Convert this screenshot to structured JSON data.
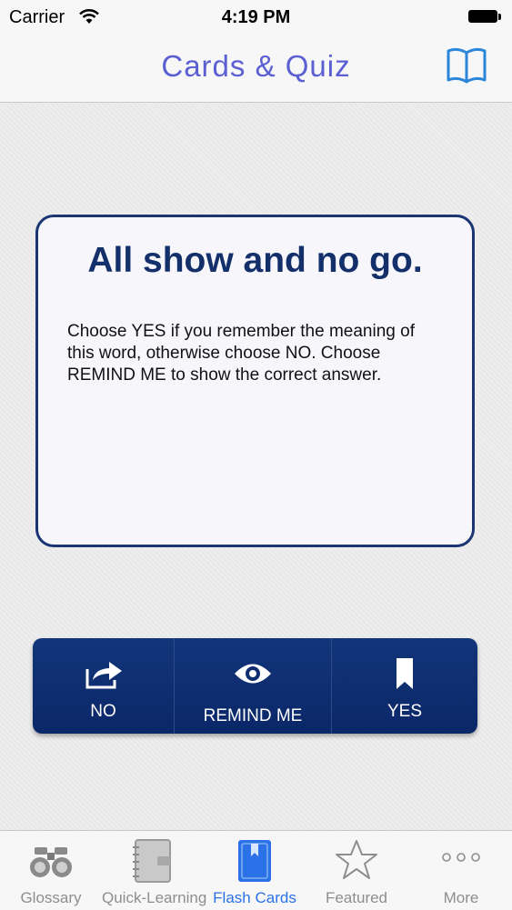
{
  "status": {
    "carrier": "Carrier",
    "time": "4:19 PM"
  },
  "nav": {
    "title": "Cards & Quiz"
  },
  "card": {
    "title": "All show and no go.",
    "text": "Choose YES if you remember the meaning of this word, otherwise choose NO. Choose REMIND ME to show the correct answer."
  },
  "actions": {
    "no": "NO",
    "remind": "REMIND ME",
    "yes": "YES"
  },
  "tabs": [
    {
      "label": "Glossary",
      "icon": "binoculars-icon"
    },
    {
      "label": "Quick-Learning",
      "icon": "notebook-icon"
    },
    {
      "label": "Flash Cards",
      "icon": "flash-cards-icon"
    },
    {
      "label": "Featured",
      "icon": "star-icon"
    },
    {
      "label": "More",
      "icon": "more-dots-icon"
    }
  ],
  "colors": {
    "accent": "#2b72e8",
    "navy": "#13306b",
    "title": "#5b5fd1"
  }
}
